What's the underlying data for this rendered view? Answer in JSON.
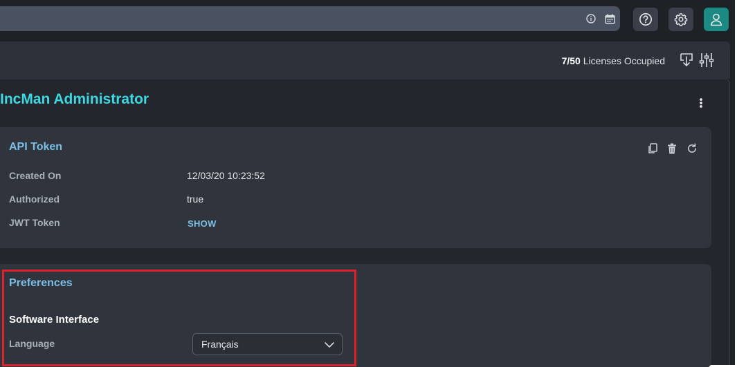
{
  "topbar": {
    "info_icon": "info-circle-icon",
    "calendar_icon": "calendar-icon",
    "help_icon": "help-circle-icon",
    "settings_icon": "gear-icon",
    "user_icon": "user-icon"
  },
  "header": {
    "licenses_count": "7/50",
    "licenses_text": "Licenses Occupied",
    "download_icon": "download-icon",
    "filters_icon": "sliders-icon"
  },
  "page": {
    "title": "IncMan Administrator",
    "more_icon": "kebab-menu-icon"
  },
  "api_token": {
    "title": "API Token",
    "actions": [
      "copy-icon",
      "trash-icon",
      "refresh-icon"
    ],
    "rows": [
      {
        "label": "Created On",
        "value": "12/03/20 10:23:52"
      },
      {
        "label": "Authorized",
        "value": "true"
      },
      {
        "label": "JWT Token",
        "link": "SHOW"
      }
    ]
  },
  "preferences": {
    "title": "Preferences",
    "section": "Software Interface",
    "language_label": "Language",
    "language_value": "Français"
  },
  "colors": {
    "accent_title": "#3dd9e3",
    "link_blue": "#7dbfe6",
    "user_button": "#1a8a82",
    "highlight": "#e0202a"
  }
}
